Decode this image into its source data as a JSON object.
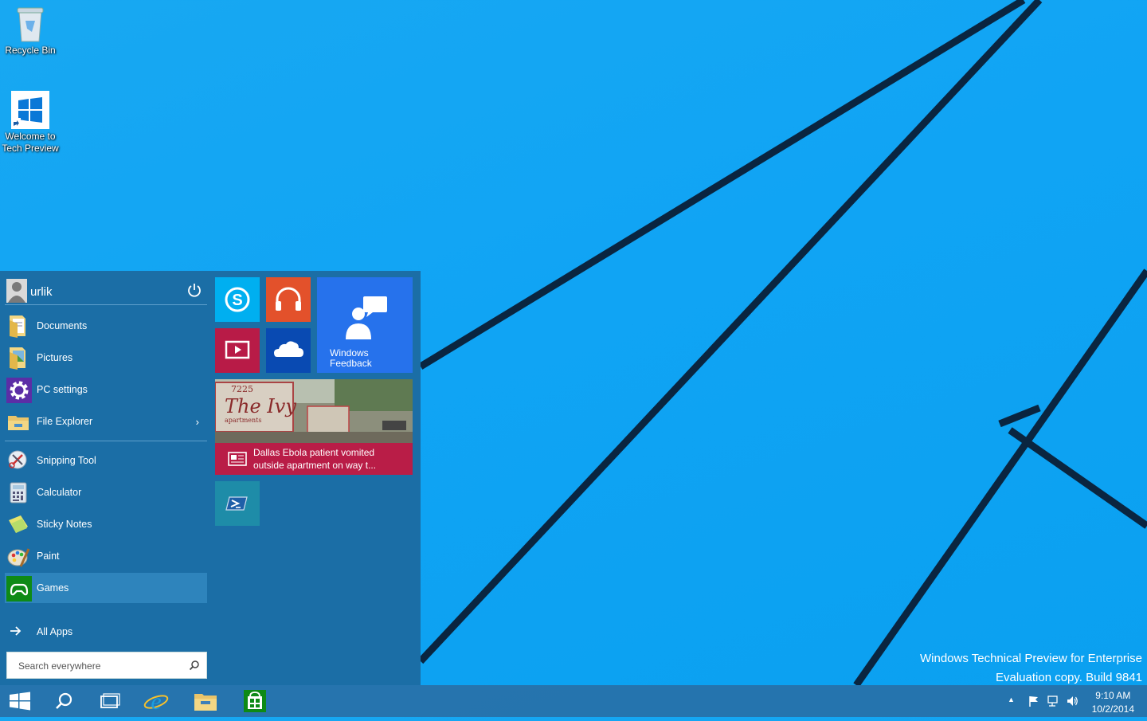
{
  "desktop": {
    "icons": [
      {
        "label": "Recycle Bin",
        "icon": "recycle-bin-icon"
      },
      {
        "label_line1": "Welcome to",
        "label_line2": "Tech Preview",
        "icon": "windows-logo-icon"
      }
    ],
    "watermark": {
      "line1": "Windows Technical Preview for Enterprise",
      "line2": "Evaluation copy. Build 9841"
    }
  },
  "start_menu": {
    "user": {
      "name": "urlik",
      "icon": "user-avatar-icon",
      "power_icon": "power-icon"
    },
    "places": [
      {
        "label": "Documents",
        "icon": "documents-folder-icon"
      },
      {
        "label": "Pictures",
        "icon": "pictures-folder-icon"
      },
      {
        "label": "PC settings",
        "icon": "gear-icon"
      },
      {
        "label": "File Explorer",
        "icon": "file-explorer-icon",
        "chevron": "›"
      }
    ],
    "apps": [
      {
        "label": "Snipping Tool",
        "icon": "snipping-tool-icon"
      },
      {
        "label": "Calculator",
        "icon": "calculator-icon"
      },
      {
        "label": "Sticky Notes",
        "icon": "sticky-notes-icon"
      },
      {
        "label": "Paint",
        "icon": "paint-icon"
      },
      {
        "label": "Games",
        "icon": "games-controller-icon",
        "selected": true
      }
    ],
    "all_apps": {
      "label": "All Apps",
      "icon": "arrow-right-icon"
    },
    "search": {
      "placeholder": "Search everywhere",
      "icon": "search-icon"
    },
    "tiles": {
      "skype": {
        "icon": "skype-icon",
        "color": "#00aff0"
      },
      "music": {
        "icon": "headphones-icon",
        "color": "#e3512b"
      },
      "video": {
        "icon": "video-icon",
        "color": "#b81b47"
      },
      "onedrive": {
        "icon": "onedrive-cloud-icon",
        "color": "#094ab2"
      },
      "feedback": {
        "label_line1": "Windows",
        "label_line2": "Feedback",
        "icon": "feedback-icon",
        "color": "#2672ec"
      },
      "news": {
        "caption_line1": "Dallas Ebola patient vomited",
        "caption_line2": "outside apartment on way t...",
        "sign_number": "7225",
        "sign_name": "The Ivy",
        "sign_sub": "apartments",
        "icon": "news-icon",
        "color": "#b91d47"
      },
      "powershell": {
        "icon": "powershell-icon",
        "color": "#1e8ca8"
      }
    }
  },
  "taskbar": {
    "buttons": [
      {
        "name": "start",
        "icon": "windows-logo-icon"
      },
      {
        "name": "search",
        "icon": "search-icon"
      },
      {
        "name": "task-view",
        "icon": "task-view-icon"
      },
      {
        "name": "internet-explorer",
        "icon": "internet-explorer-icon"
      },
      {
        "name": "file-explorer",
        "icon": "file-explorer-icon"
      },
      {
        "name": "store",
        "icon": "store-icon"
      }
    ],
    "tray": {
      "chevron": "▲",
      "icons": [
        "action-flag-icon",
        "network-icon",
        "volume-icon"
      ]
    },
    "clock": {
      "time": "9:10 AM",
      "date": "10/2/2014"
    }
  }
}
